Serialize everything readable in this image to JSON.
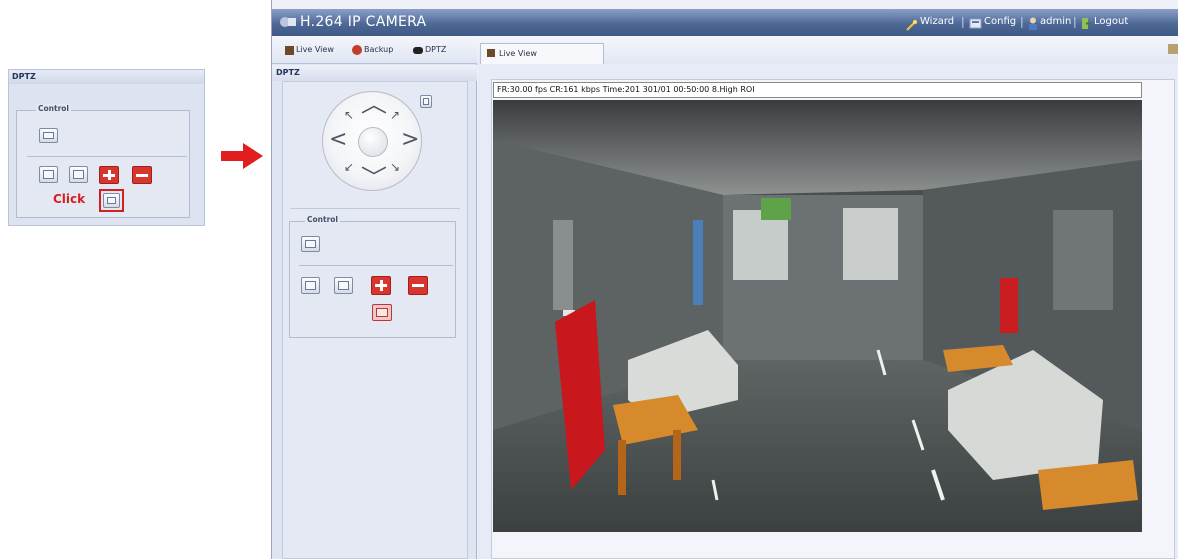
{
  "inset": {
    "panel_title": "DPTZ",
    "control_label": "Control",
    "click_label": "Click"
  },
  "app": {
    "title": "H.264 IP CAMERA",
    "links": [
      "Wizard",
      "Config",
      "admin",
      "Logout"
    ],
    "nav_tabs": [
      "Live View",
      "Backup",
      "DPTZ"
    ],
    "panel_title": "DPTZ",
    "control_label": "Control",
    "main_tab": "Live View",
    "status_line": "FR:30.00 fps  CR:161 kbps Time:201 301/01 00:50:00 8.High ROI"
  },
  "colors": {
    "title_bar": "#4e6896",
    "panel_bg": "#dfe5f2",
    "accent_red": "#d9352f",
    "click_text": "#d41f1f"
  },
  "icons": {
    "arrow": "red-right-arrow",
    "wizard": "wand-icon",
    "config": "config-icon",
    "admin": "user-icon",
    "logout": "logout-icon"
  }
}
